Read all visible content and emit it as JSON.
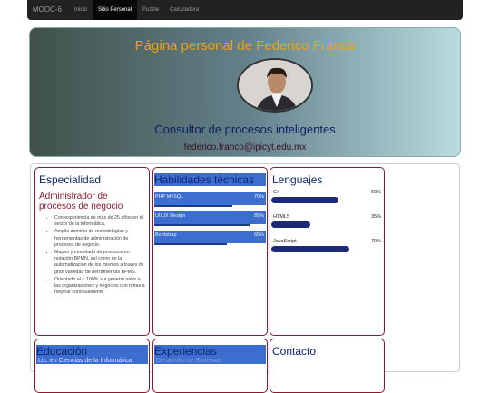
{
  "navbar": {
    "brand": "MOOC-6",
    "items": [
      "Inicio",
      "Sitio Personal",
      "Puzzle",
      "Calculadora"
    ]
  },
  "hero": {
    "title": "Página personal de Federico Franco",
    "subtitle": "Consultor de procesos inteligentes",
    "email": "federico.franco@ipicyt.edu.mx"
  },
  "especialidad": {
    "title": "Especialidad",
    "subtitle": "Administrador de procesos de negocio",
    "items": [
      "Con experiencia de más de 25 años en el sector de la informática.",
      "Amplio dominio de metodologías y herramientas de administración de procesos de negocio.",
      "Mapeo y modelado de procesos en notación BPMN, así como en la automatización de los mismos a traves de gran variedad de herramientas BPMS.",
      "Orientado al < 100% > a generar valor a las organizaciones y negocios con miras a mejorar continuamente."
    ]
  },
  "habilidades": {
    "title": "Habilidades técnicas",
    "skills": [
      {
        "label": "PHP MySQL",
        "percent": "70%",
        "level": 0.7
      },
      {
        "label": "UI/UX Design",
        "percent": "85%",
        "level": 0.85
      },
      {
        "label": "Bootstrap",
        "percent": "65%",
        "level": 0.65
      }
    ]
  },
  "lenguajes": {
    "title": "Lenguajes",
    "items": [
      {
        "label": "C#",
        "percent": "60%",
        "level": 0.6
      },
      {
        "label": "HTML5",
        "percent": "35%",
        "level": 0.35
      },
      {
        "label": "JavaScript",
        "percent": "70%",
        "level": 0.7
      }
    ]
  },
  "educacion": {
    "title": "Educación",
    "first_line": "Lic. en Ciencias de la Informática"
  },
  "experiencias": {
    "title": "Experiencias",
    "first_line": "Desarrollo de Sistemas"
  },
  "contacto": {
    "title": "Contacto"
  },
  "colors": {
    "accent": "#3c6ecf",
    "border": "#8b1a2e",
    "title": "#f0a40c",
    "navy": "#0c2470"
  }
}
